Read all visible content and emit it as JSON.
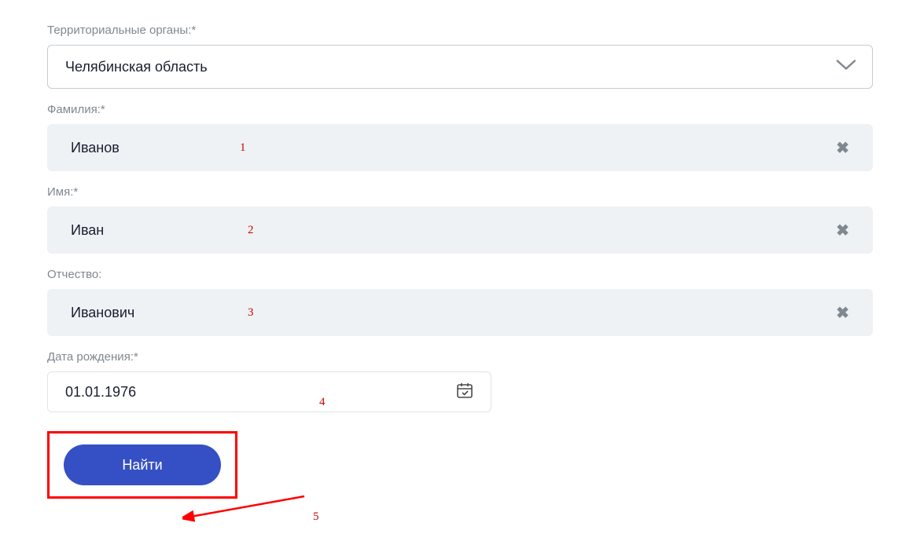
{
  "form": {
    "territory": {
      "label": "Территориальные органы:*",
      "value": "Челябинская область"
    },
    "lastname": {
      "label": "Фамилия:*",
      "value": "Иванов"
    },
    "firstname": {
      "label": "Имя:*",
      "value": "Иван"
    },
    "patronymic": {
      "label": "Отчество:",
      "value": "Иванович"
    },
    "birthdate": {
      "label": "Дата рождения:*",
      "value": "01.01.1976"
    },
    "submit": {
      "label": "Найти"
    }
  },
  "annotations": {
    "a1": "1",
    "a2": "2",
    "a3": "3",
    "a4": "4",
    "a5": "5"
  }
}
